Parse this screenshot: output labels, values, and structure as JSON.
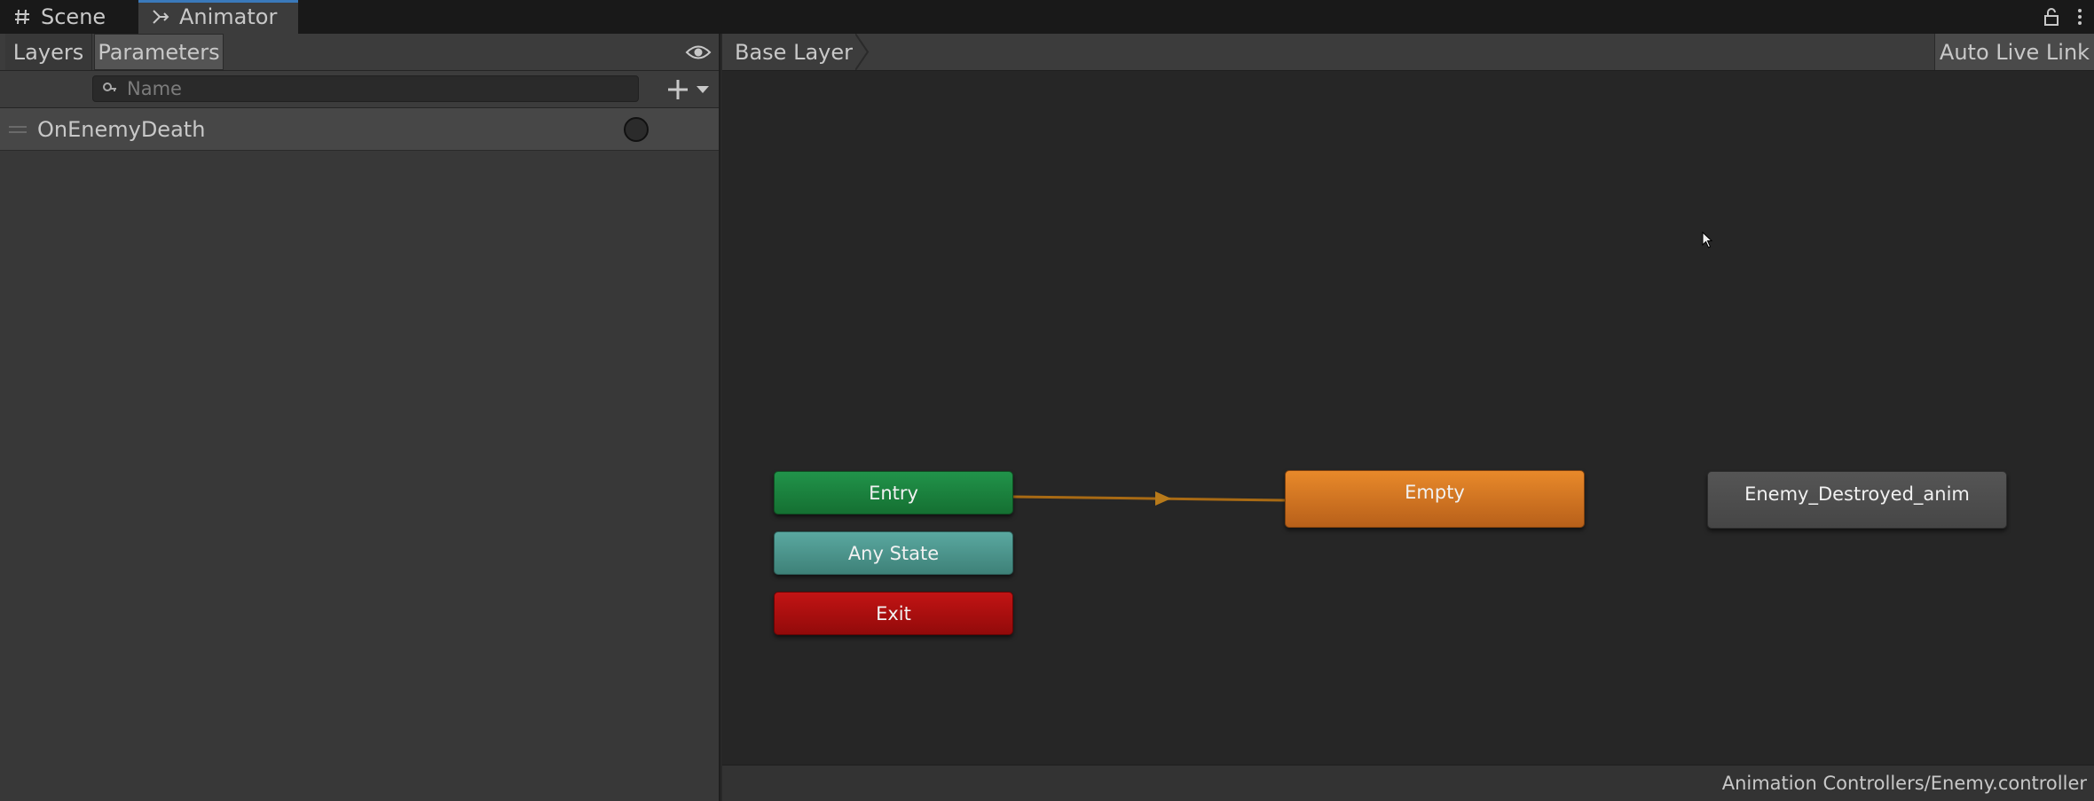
{
  "tabs": {
    "scene": {
      "label": "Scene",
      "icon": "hash-icon"
    },
    "animator": {
      "label": "Animator",
      "icon": "animator-icon",
      "active": true
    }
  },
  "colors": {
    "active_tab_accent": "#3a79bb",
    "entry": "#1b8a40",
    "any_state": "#4e968e",
    "exit": "#b01010",
    "default_state": "#d47a24",
    "state": "#4f4f4f",
    "transition": "#a86a14"
  },
  "left_panel": {
    "tab_layers": "Layers",
    "tab_parameters": "Parameters",
    "active_tab": "Parameters",
    "search_placeholder": "Name",
    "parameters": [
      {
        "name": "OnEnemyDeath",
        "type": "trigger",
        "value": "off"
      }
    ]
  },
  "graph": {
    "breadcrumb": "Base Layer",
    "auto_live_link": "Auto Live Link",
    "nodes": {
      "entry": "Entry",
      "any_state": "Any State",
      "exit": "Exit",
      "empty": "Empty",
      "destroyed": "Enemy_Destroyed_anim"
    },
    "status_path": "Animation Controllers/Enemy.controller"
  }
}
